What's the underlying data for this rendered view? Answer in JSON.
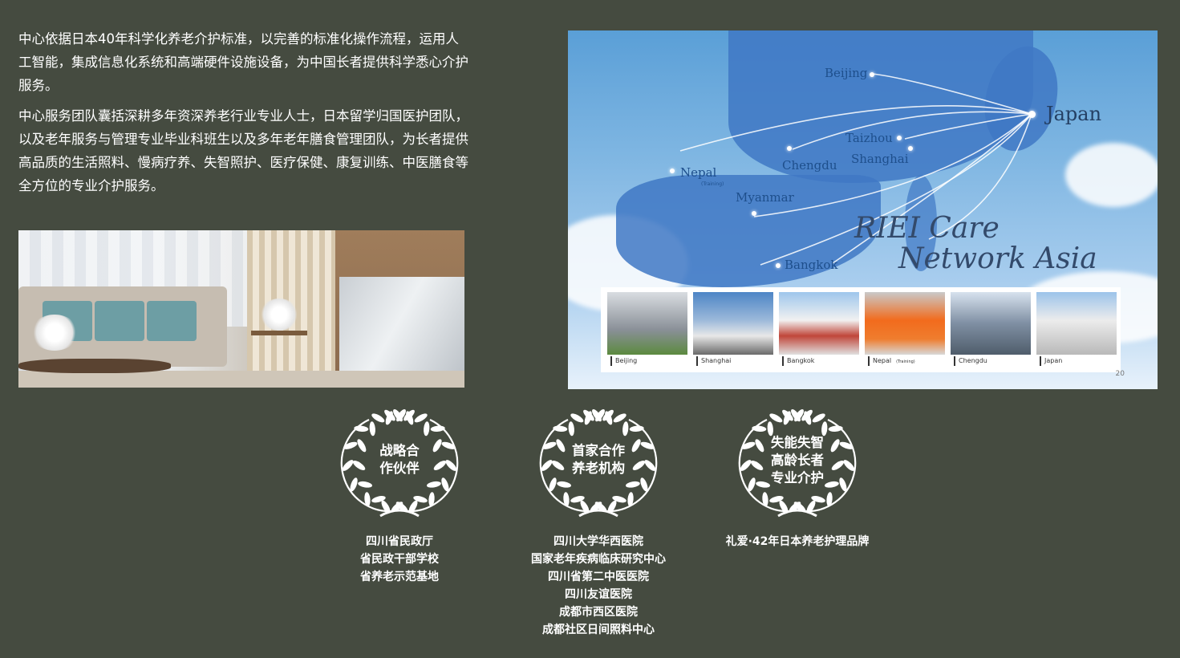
{
  "intro": {
    "p1": "中心依据日本40年科学化养老介护标准，以完善的标准化操作流程，运用人工智能，集成信息化系统和高端硬件设施设备，为中国长者提供科学悉心介护服务。",
    "p2": "中心服务团队囊括深耕多年资深养老行业专业人士，日本留学归国医护团队，以及老年服务与管理专业毕业科班生以及多年老年膳食管理团队，为长者提供高品质的生活照料、慢病疗养、失智照护、医疗保健、康复训练、中医膳食等全方位的专业介护服务。"
  },
  "map": {
    "cities": {
      "beijing": "Beijing",
      "japan": "Japan",
      "taizhou": "Taizhou",
      "shanghai": "Shanghai",
      "chengdu": "Chengdu",
      "nepal": "Nepal",
      "nepal_note": "(Training)",
      "myanmar": "Myanmar",
      "bangkok": "Bangkok"
    },
    "brand_line1": "RIEI Care",
    "brand_line2": "Network Asia",
    "thumbnails": [
      {
        "label": "Beijing",
        "note": ""
      },
      {
        "label": "Shanghai",
        "note": ""
      },
      {
        "label": "Bangkok",
        "note": ""
      },
      {
        "label": "Nepal",
        "note": "(Training)"
      },
      {
        "label": "Chengdu",
        "note": ""
      },
      {
        "label": "Japan",
        "note": ""
      }
    ],
    "page_number": "20"
  },
  "badges": [
    {
      "line1": "战略合",
      "line2": "作伙伴",
      "line3": ""
    },
    {
      "line1": "首家合作",
      "line2": "养老机构",
      "line3": ""
    },
    {
      "line1": "失能失智",
      "line2": "高龄长者",
      "line3": "专业介护"
    }
  ],
  "columns": {
    "c1": [
      "四川省民政厅",
      "省民政干部学校",
      "省养老示范基地"
    ],
    "c2": [
      "四川大学华西医院",
      "国家老年疾病临床研究中心",
      "四川省第二中医医院",
      "四川友谊医院",
      "成都市西区医院",
      "成都社区日间照料中心"
    ],
    "c3": [
      "礼爱·42年日本养老护理品牌"
    ]
  },
  "colors": {
    "background": "#454b40",
    "text": "#ffffff",
    "map_sky": "#7fb6e2",
    "map_land": "#3f78c4"
  }
}
